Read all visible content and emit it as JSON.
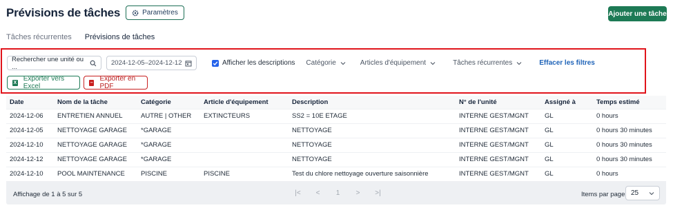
{
  "header": {
    "title": "Prévisions de tâches",
    "params_label": "Paramètres",
    "add_task_label": "Ajouter une tâche"
  },
  "tabs": [
    {
      "label": "Tâches récurrentes",
      "active": false
    },
    {
      "label": "Prévisions de tâches",
      "active": true
    }
  ],
  "filters": {
    "search_value": "Rechercher une unité ou ...",
    "date_range": "2024-12-05–2024-12-12",
    "show_descriptions_label": "Afficher les descriptions",
    "show_descriptions_checked": true,
    "category_label": "Catégorie",
    "equipment_label": "Articles d'équipement",
    "recurring_label": "Tâches récurrentes",
    "clear_label": "Effacer les filtres"
  },
  "exports": {
    "excel_label": "Exporter vers Excel",
    "excel_icon": "X",
    "pdf_label": "Exporter en PDF",
    "pdf_icon": "–"
  },
  "table": {
    "headers": {
      "date": "Date",
      "task": "Nom de la tâche",
      "category": "Catégorie",
      "equipment": "Article d'équipement",
      "description": "Description",
      "unit": "N° de l'unité",
      "assigned": "Assigné à",
      "time": "Temps estimé"
    },
    "rows": [
      {
        "date": "2024-12-06",
        "task": "ENTRETIEN ANNUEL",
        "category": "AUTRE | OTHER",
        "equipment": "EXTINCTEURS",
        "description": "SS2 = 10E ETAGE",
        "unit": "INTERNE GEST/MGNT",
        "assigned": "GL",
        "time": "0 hours"
      },
      {
        "date": "2024-12-05",
        "task": "NETTOYAGE GARAGE",
        "category": "*GARAGE",
        "equipment": "",
        "description": "NETTOYAGE",
        "unit": "INTERNE GEST/MGNT",
        "assigned": "GL",
        "time": "0 hours 30 minutes"
      },
      {
        "date": "2024-12-10",
        "task": "NETTOYAGE GARAGE",
        "category": "*GARAGE",
        "equipment": "",
        "description": "NETTOYAGE",
        "unit": "INTERNE GEST/MGNT",
        "assigned": "GL",
        "time": "0 hours 30 minutes"
      },
      {
        "date": "2024-12-12",
        "task": "NETTOYAGE GARAGE",
        "category": "*GARAGE",
        "equipment": "",
        "description": "NETTOYAGE",
        "unit": "INTERNE GEST/MGNT",
        "assigned": "GL",
        "time": "0 hours 30 minutes"
      },
      {
        "date": "2024-12-10",
        "task": "POOL MAINTENANCE",
        "category": "PISCINE",
        "equipment": "PISCINE",
        "description": "Test du chlore nettoyage ouverture saisonnière",
        "unit": "INTERNE GEST/MGNT",
        "assigned": "GL",
        "time": "0 hours"
      }
    ]
  },
  "pagination": {
    "info": "Affichage de 1 à 5 sur 5",
    "first": "|<",
    "prev": "<",
    "page": "1",
    "next": ">",
    "last": ">|",
    "per_page_label": "Items par page",
    "per_page_value": "25"
  },
  "colors": {
    "accent": "#1d7a55",
    "highlight_border": "#e0131a",
    "link": "#1e63b8",
    "checkbox": "#2563eb"
  }
}
